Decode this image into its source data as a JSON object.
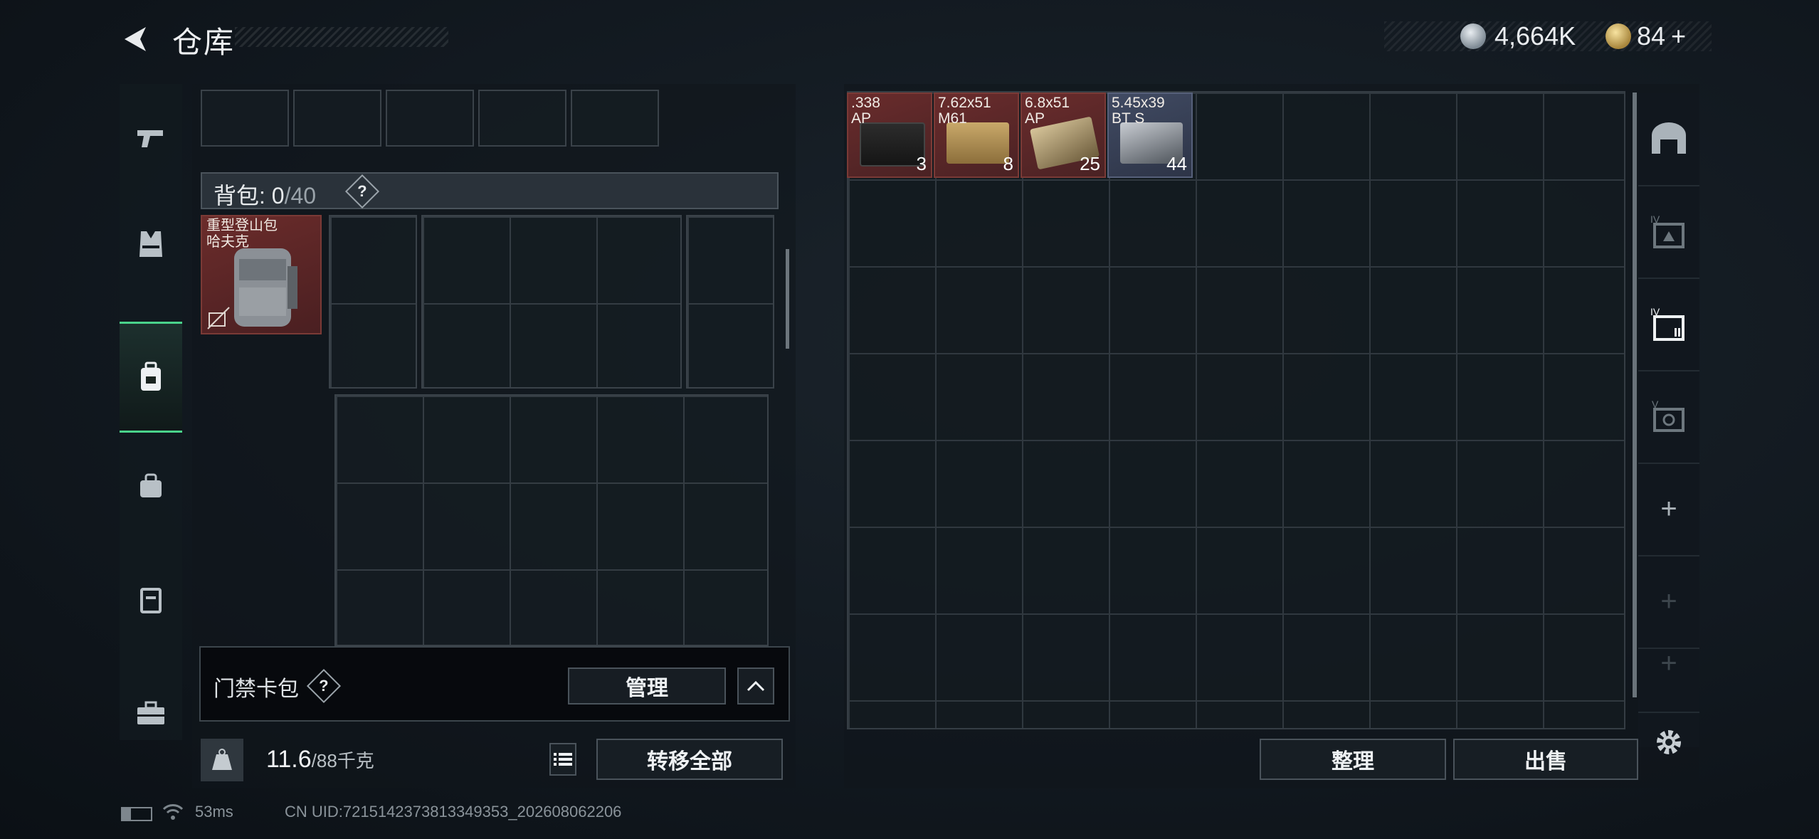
{
  "header": {
    "title": "仓库",
    "currency": [
      {
        "icon": "silver-coin-icon",
        "value": "4,664K"
      },
      {
        "icon": "gold-coin-icon",
        "value": "84",
        "add": "+"
      }
    ]
  },
  "left_nav": {
    "items": [
      {
        "name": "weapon",
        "icon": "pistol-icon",
        "active": false
      },
      {
        "name": "armor",
        "icon": "vest-icon",
        "active": false
      },
      {
        "name": "backpack",
        "icon": "backpack-icon",
        "active": true
      },
      {
        "name": "pouch",
        "icon": "pouch-icon",
        "active": false
      },
      {
        "name": "case",
        "icon": "case-icon",
        "active": false
      },
      {
        "name": "toolbox",
        "icon": "toolbox-icon",
        "active": false
      }
    ]
  },
  "backpack": {
    "label": "背包: ",
    "count": "0",
    "capacity": "/40",
    "help": "?",
    "equipped_item": {
      "name_line1": "重型登山包",
      "name_line2": "哈夫克"
    }
  },
  "keycard": {
    "label": "门禁卡包",
    "help": "?",
    "manage_label": "管理"
  },
  "weight": {
    "icon_label": "KG",
    "current": "11.6",
    "max": "/88千克",
    "transfer_all_label": "转移全部"
  },
  "stash": {
    "items": [
      {
        "line1": ".338",
        "line2": "AP",
        "count": "3",
        "rarity_color": "#6a2c2c"
      },
      {
        "line1": "7.62x51",
        "line2": "M61",
        "count": "8",
        "rarity_color": "#6a2c2c"
      },
      {
        "line1": "6.8x51",
        "line2": "AP",
        "count": "25",
        "rarity_color": "#6a2c2c"
      },
      {
        "line1": "5.45x39",
        "line2": "BT S",
        "count": "44",
        "rarity_color": "#414b63"
      }
    ],
    "sort_label": "整理",
    "sell_label": "出售"
  },
  "right_nav": {
    "items": [
      {
        "icon": "stash-arch-icon",
        "tier": ""
      },
      {
        "icon": "container-iv-icon",
        "tier": "IV"
      },
      {
        "icon": "container-iv-active-icon",
        "tier": "IV"
      },
      {
        "icon": "container-v-icon",
        "tier": "V"
      }
    ],
    "add": "+"
  },
  "status": {
    "ping": "53ms",
    "uid": "CN UID:7215142373813349353_202608062206"
  }
}
